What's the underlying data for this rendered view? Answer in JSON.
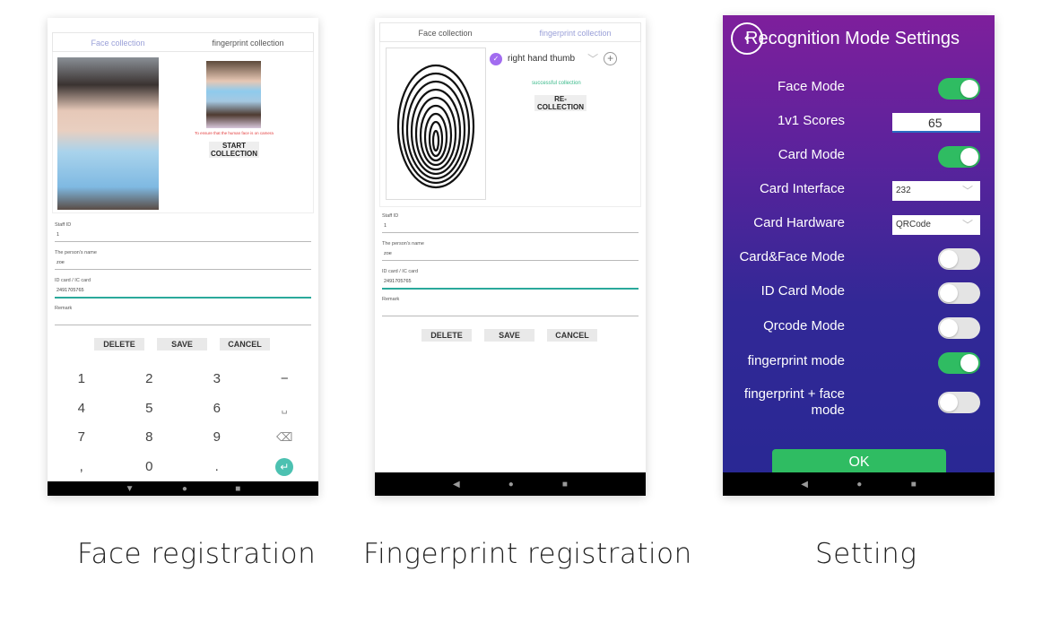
{
  "captions": [
    "Face registration",
    "Fingerprint registration",
    "Setting"
  ],
  "registration": {
    "tabs": [
      "Face collection",
      "fingerprint collection"
    ],
    "face": {
      "warning": "To ensure that the human face is on camera",
      "start_button": "START COLLECTION"
    },
    "fingerprint": {
      "finger_select": "right hand thumb",
      "status": "successful collection",
      "recollect_button": "RE-COLLECTION"
    },
    "form": [
      {
        "label": "Staff ID",
        "value": "1"
      },
      {
        "label": "The person's name",
        "value": "zoe"
      },
      {
        "label": "ID card / IC card",
        "value": "2491705765"
      },
      {
        "label": "Remark",
        "value": ""
      }
    ],
    "buttons": {
      "delete": "DELETE",
      "save": "SAVE",
      "cancel": "CANCEL"
    },
    "keypad": [
      "1",
      "2",
      "3",
      "−",
      "4",
      "5",
      "6",
      "␣",
      "7",
      "8",
      "9",
      "⌫",
      ",",
      "0",
      ".",
      "↵"
    ]
  },
  "navbar": {
    "back": "◀",
    "home": "●",
    "recents": "■",
    "back_down": "▼"
  },
  "settings": {
    "title": "Recognition Mode Settings",
    "rows": [
      {
        "label": "Face Mode",
        "type": "toggle",
        "on": true
      },
      {
        "label": "1v1 Scores",
        "type": "input",
        "value": "65"
      },
      {
        "label": "Card Mode",
        "type": "toggle",
        "on": true
      },
      {
        "label": "Card Interface",
        "type": "select",
        "value": "232"
      },
      {
        "label": "Card Hardware",
        "type": "select",
        "value": "QRCode"
      },
      {
        "label": "Card&Face Mode",
        "type": "toggle",
        "on": false
      },
      {
        "label": "ID Card Mode",
        "type": "toggle",
        "on": false
      },
      {
        "label": "Qrcode Mode",
        "type": "toggle",
        "on": false
      },
      {
        "label": "fingerprint mode",
        "type": "toggle",
        "on": true
      },
      {
        "label": "fingerprint + face mode",
        "type": "toggle",
        "on": false
      }
    ],
    "ok_button": "OK",
    "colors": {
      "toggle_on": "#2fbc62",
      "toggle_off": "#e4e4e4"
    }
  }
}
